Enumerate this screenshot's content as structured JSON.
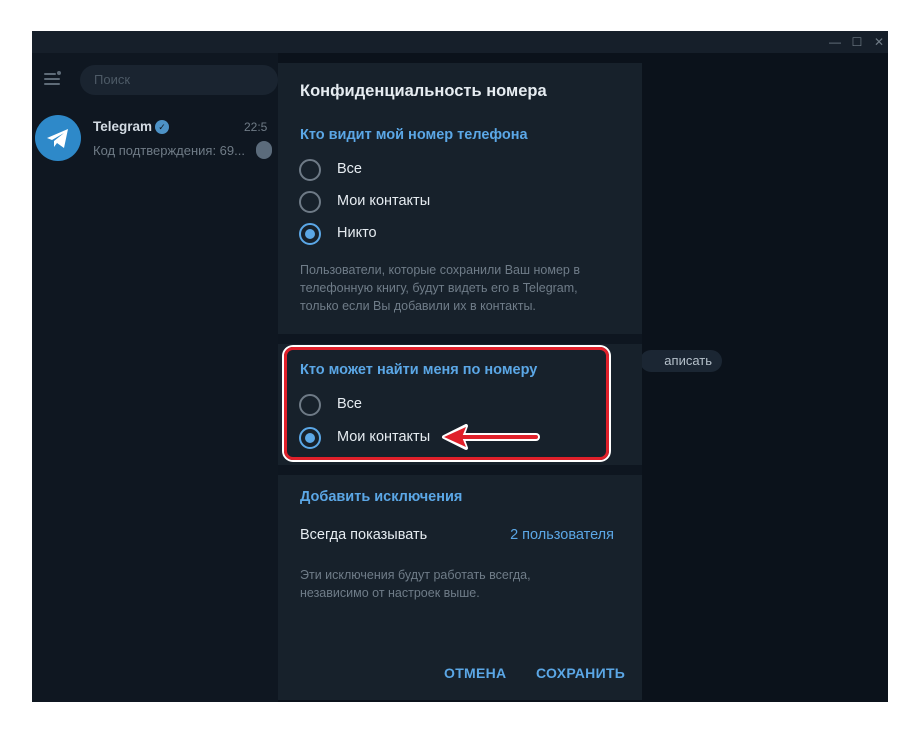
{
  "window": {
    "controls": [
      "—",
      "☐",
      "✕"
    ]
  },
  "sidebar": {
    "search_placeholder": "Поиск",
    "chat": {
      "name": "Telegram",
      "time": "22:5",
      "preview": "Код подтверждения: 69..."
    }
  },
  "background": {
    "write_label": "аписать"
  },
  "dialog": {
    "title": "Конфиденциальность номера",
    "section1": {
      "title": "Кто видит мой номер телефона",
      "options": [
        "Все",
        "Мои контакты",
        "Никто"
      ],
      "selected_index": 2,
      "description_lines": [
        "Пользователи, которые сохранили Ваш номер в",
        "телефонную книгу, будут видеть его в Telegram,",
        "только если Вы добавили их в контакты."
      ]
    },
    "section2": {
      "title": "Кто может найти меня по номеру",
      "options": [
        "Все",
        "Мои контакты"
      ],
      "selected_index": 1
    },
    "exceptions": {
      "title": "Добавить исключения",
      "always_show_label": "Всегда показывать",
      "always_show_value": "2 пользователя",
      "description_lines": [
        "Эти исключения будут работать всегда,",
        "независимо от настроек выше."
      ]
    },
    "buttons": {
      "cancel": "ОТМЕНА",
      "save": "СОХРАНИТЬ"
    }
  },
  "colors": {
    "accent": "#5ba7e6",
    "annotation": "#e0202a",
    "dialog_bg": "#17212b"
  }
}
